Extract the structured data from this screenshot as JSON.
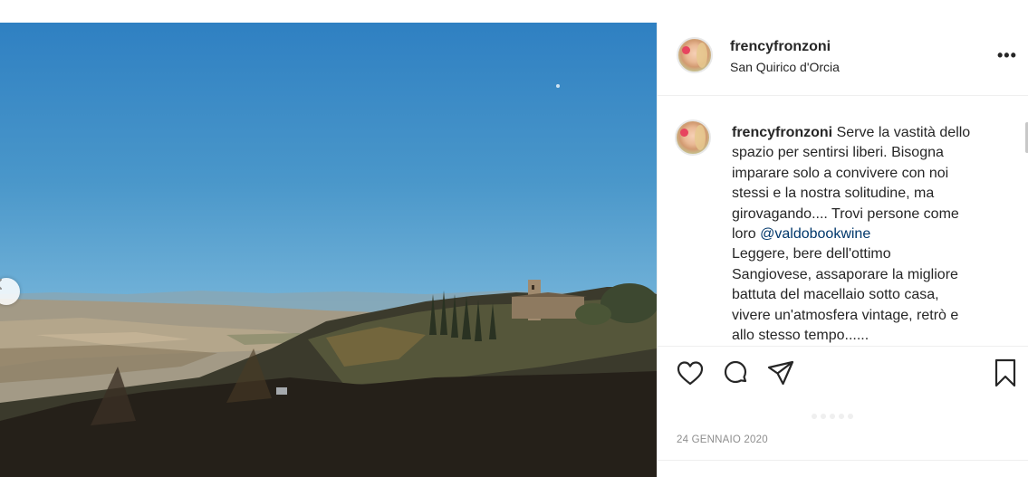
{
  "post": {
    "username": "frencyfronzoni",
    "location": "San Quirico d'Orcia",
    "more_label": "•••",
    "caption_line1_rest": " Serve la vastità dello\nspazio per sentirsi liberi. Bisogna\nimparare solo a convivere con noi\nstessi e la nostra solitudine, ma\ngirovagando.... Trovi persone come\nloro ",
    "mention": "@valdobookwine",
    "caption_line2": "\nLeggere, bere dell'ottimo\nSangiovese, assaporare la migliore\nbattuta del macellaio sotto casa,\nvivere un'atmosfera vintage, retrò e\nallo stesso tempo......",
    "date": "24 GENNAIO 2020"
  },
  "icons": {
    "prev": "chevron-left-icon",
    "like": "heart-icon",
    "comment": "comment-icon",
    "share": "paper-plane-icon",
    "save": "bookmark-icon"
  },
  "colors": {
    "text": "#262626",
    "muted": "#8e8e8e",
    "link": "#00376b",
    "border": "#efefef"
  }
}
